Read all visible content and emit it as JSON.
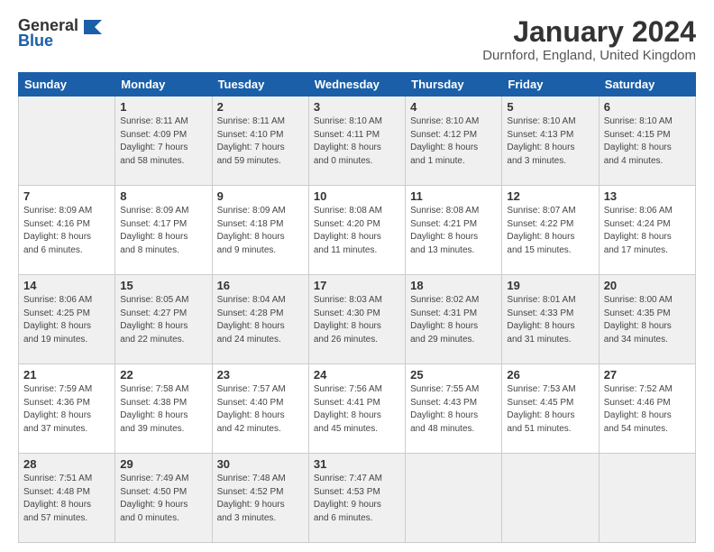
{
  "logo": {
    "general": "General",
    "blue": "Blue"
  },
  "title": "January 2024",
  "location": "Durnford, England, United Kingdom",
  "weekdays": [
    "Sunday",
    "Monday",
    "Tuesday",
    "Wednesday",
    "Thursday",
    "Friday",
    "Saturday"
  ],
  "weeks": [
    [
      {
        "day": "",
        "info": ""
      },
      {
        "day": "1",
        "info": "Sunrise: 8:11 AM\nSunset: 4:09 PM\nDaylight: 7 hours\nand 58 minutes."
      },
      {
        "day": "2",
        "info": "Sunrise: 8:11 AM\nSunset: 4:10 PM\nDaylight: 7 hours\nand 59 minutes."
      },
      {
        "day": "3",
        "info": "Sunrise: 8:10 AM\nSunset: 4:11 PM\nDaylight: 8 hours\nand 0 minutes."
      },
      {
        "day": "4",
        "info": "Sunrise: 8:10 AM\nSunset: 4:12 PM\nDaylight: 8 hours\nand 1 minute."
      },
      {
        "day": "5",
        "info": "Sunrise: 8:10 AM\nSunset: 4:13 PM\nDaylight: 8 hours\nand 3 minutes."
      },
      {
        "day": "6",
        "info": "Sunrise: 8:10 AM\nSunset: 4:15 PM\nDaylight: 8 hours\nand 4 minutes."
      }
    ],
    [
      {
        "day": "7",
        "info": "Sunrise: 8:09 AM\nSunset: 4:16 PM\nDaylight: 8 hours\nand 6 minutes."
      },
      {
        "day": "8",
        "info": "Sunrise: 8:09 AM\nSunset: 4:17 PM\nDaylight: 8 hours\nand 8 minutes."
      },
      {
        "day": "9",
        "info": "Sunrise: 8:09 AM\nSunset: 4:18 PM\nDaylight: 8 hours\nand 9 minutes."
      },
      {
        "day": "10",
        "info": "Sunrise: 8:08 AM\nSunset: 4:20 PM\nDaylight: 8 hours\nand 11 minutes."
      },
      {
        "day": "11",
        "info": "Sunrise: 8:08 AM\nSunset: 4:21 PM\nDaylight: 8 hours\nand 13 minutes."
      },
      {
        "day": "12",
        "info": "Sunrise: 8:07 AM\nSunset: 4:22 PM\nDaylight: 8 hours\nand 15 minutes."
      },
      {
        "day": "13",
        "info": "Sunrise: 8:06 AM\nSunset: 4:24 PM\nDaylight: 8 hours\nand 17 minutes."
      }
    ],
    [
      {
        "day": "14",
        "info": "Sunrise: 8:06 AM\nSunset: 4:25 PM\nDaylight: 8 hours\nand 19 minutes."
      },
      {
        "day": "15",
        "info": "Sunrise: 8:05 AM\nSunset: 4:27 PM\nDaylight: 8 hours\nand 22 minutes."
      },
      {
        "day": "16",
        "info": "Sunrise: 8:04 AM\nSunset: 4:28 PM\nDaylight: 8 hours\nand 24 minutes."
      },
      {
        "day": "17",
        "info": "Sunrise: 8:03 AM\nSunset: 4:30 PM\nDaylight: 8 hours\nand 26 minutes."
      },
      {
        "day": "18",
        "info": "Sunrise: 8:02 AM\nSunset: 4:31 PM\nDaylight: 8 hours\nand 29 minutes."
      },
      {
        "day": "19",
        "info": "Sunrise: 8:01 AM\nSunset: 4:33 PM\nDaylight: 8 hours\nand 31 minutes."
      },
      {
        "day": "20",
        "info": "Sunrise: 8:00 AM\nSunset: 4:35 PM\nDaylight: 8 hours\nand 34 minutes."
      }
    ],
    [
      {
        "day": "21",
        "info": "Sunrise: 7:59 AM\nSunset: 4:36 PM\nDaylight: 8 hours\nand 37 minutes."
      },
      {
        "day": "22",
        "info": "Sunrise: 7:58 AM\nSunset: 4:38 PM\nDaylight: 8 hours\nand 39 minutes."
      },
      {
        "day": "23",
        "info": "Sunrise: 7:57 AM\nSunset: 4:40 PM\nDaylight: 8 hours\nand 42 minutes."
      },
      {
        "day": "24",
        "info": "Sunrise: 7:56 AM\nSunset: 4:41 PM\nDaylight: 8 hours\nand 45 minutes."
      },
      {
        "day": "25",
        "info": "Sunrise: 7:55 AM\nSunset: 4:43 PM\nDaylight: 8 hours\nand 48 minutes."
      },
      {
        "day": "26",
        "info": "Sunrise: 7:53 AM\nSunset: 4:45 PM\nDaylight: 8 hours\nand 51 minutes."
      },
      {
        "day": "27",
        "info": "Sunrise: 7:52 AM\nSunset: 4:46 PM\nDaylight: 8 hours\nand 54 minutes."
      }
    ],
    [
      {
        "day": "28",
        "info": "Sunrise: 7:51 AM\nSunset: 4:48 PM\nDaylight: 8 hours\nand 57 minutes."
      },
      {
        "day": "29",
        "info": "Sunrise: 7:49 AM\nSunset: 4:50 PM\nDaylight: 9 hours\nand 0 minutes."
      },
      {
        "day": "30",
        "info": "Sunrise: 7:48 AM\nSunset: 4:52 PM\nDaylight: 9 hours\nand 3 minutes."
      },
      {
        "day": "31",
        "info": "Sunrise: 7:47 AM\nSunset: 4:53 PM\nDaylight: 9 hours\nand 6 minutes."
      },
      {
        "day": "",
        "info": ""
      },
      {
        "day": "",
        "info": ""
      },
      {
        "day": "",
        "info": ""
      }
    ]
  ]
}
